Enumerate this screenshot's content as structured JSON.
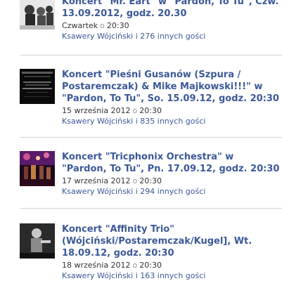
{
  "events": [
    {
      "title": "Koncert \"Mr. Eart\" w \"Pardon, To Tu\", Czw. 13.09.2012, godz. 20.30",
      "date": "Czwartek",
      "time": "20:30",
      "guests": "Ksawery Wójciński i 276 innych gości"
    },
    {
      "title": "Koncert \"Pieśni Gusanów (Szpura / Postaremczak) & Mike Majkowski!!!\" w \"Pardon, To Tu\", So. 15.09.12, godz. 20:30",
      "date": "15 września 2012",
      "time": "20:30",
      "guests": "Ksawery Wójciński i 835 innych gości"
    },
    {
      "title": "Koncert \"Tricphonix Orchestra\" w \"Pardon, To Tu\", Pn. 17.09.12, godz. 20:30",
      "date": "17 września 2012",
      "time": "20:30",
      "guests": "Ksawery Wójciński i 294 innych gości"
    },
    {
      "title": "Koncert \"Affinity Trio\" (Wójciński/Postaremczak/Kugel], Wt. 18.09.12, godz. 20:30",
      "date": "18 września 2012",
      "time": "20:30",
      "guests": "Ksawery Wójciński i 163 innych gości"
    }
  ],
  "separator_glyph": "o"
}
